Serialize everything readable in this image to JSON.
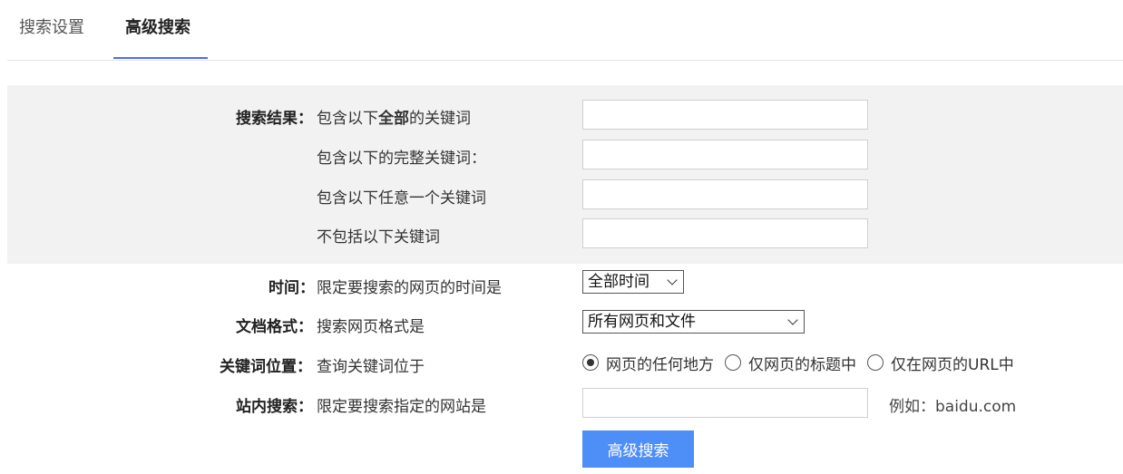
{
  "tabs": [
    {
      "label": "搜索设置"
    },
    {
      "label": "高级搜索"
    }
  ],
  "search_results": {
    "label": "搜索结果：",
    "all_prefix": "包含以下",
    "all_bold": "全部",
    "all_suffix": "的关键词",
    "exact": "包含以下的完整关键词：",
    "any": "包含以下任意一个关键词",
    "exclude": "不包括以下关键词"
  },
  "time": {
    "label": "时间：",
    "desc": "限定要搜索的网页的时间是",
    "selected": "全部时间"
  },
  "format": {
    "label": "文档格式：",
    "desc": "搜索网页格式是",
    "selected": "所有网页和文件"
  },
  "position": {
    "label": "关键词位置：",
    "desc": "查询关键词位于",
    "options": [
      {
        "label": "网页的任何地方",
        "checked": true
      },
      {
        "label": "仅网页的标题中",
        "checked": false
      },
      {
        "label": "仅在网页的URL中",
        "checked": false
      }
    ]
  },
  "site": {
    "label": "站内搜索：",
    "desc": "限定要搜索指定的网站是",
    "example": "例如：baidu.com"
  },
  "submit_label": "高级搜索"
}
